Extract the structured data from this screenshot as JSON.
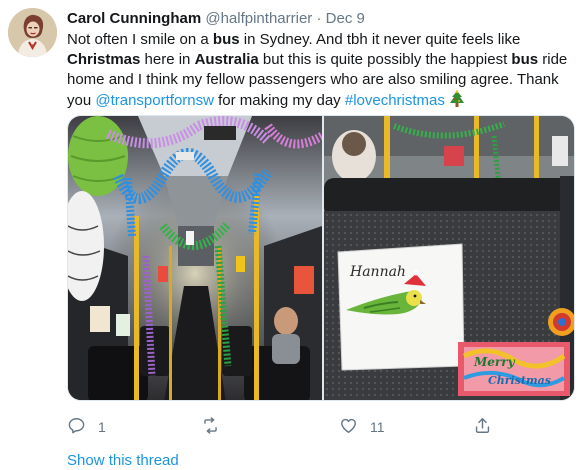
{
  "author": {
    "display_name": "Carol Cunningham",
    "handle": "@halfpintharrier",
    "separator": "·",
    "date": "Dec 9"
  },
  "tweet": {
    "t1": "Not often I smile on a ",
    "b1": "bus",
    "t2": " in Sydney. And tbh it never quite feels like ",
    "b2": "Christmas",
    "t3": " here in ",
    "b3": "Australia",
    "t4": " but this is quite possibly the happiest ",
    "b4": "bus",
    "t5": " ride home and I think my fellow passengers who are also smiling agree. Thank you ",
    "mention": "@transportfornsw",
    "t6": " for making my day ",
    "hashtag": "#lovechristmas"
  },
  "photo_right": {
    "sign_name": "Hannah",
    "card_text_1": "Merry",
    "card_text_2": "Christmas"
  },
  "actions": {
    "reply_count": "1",
    "retweet_count": "",
    "like_count": "11"
  },
  "show_thread_label": "Show this thread",
  "colors": {
    "link": "#1b95e0",
    "secondary_text": "#657786",
    "primary_text": "#14171a"
  }
}
